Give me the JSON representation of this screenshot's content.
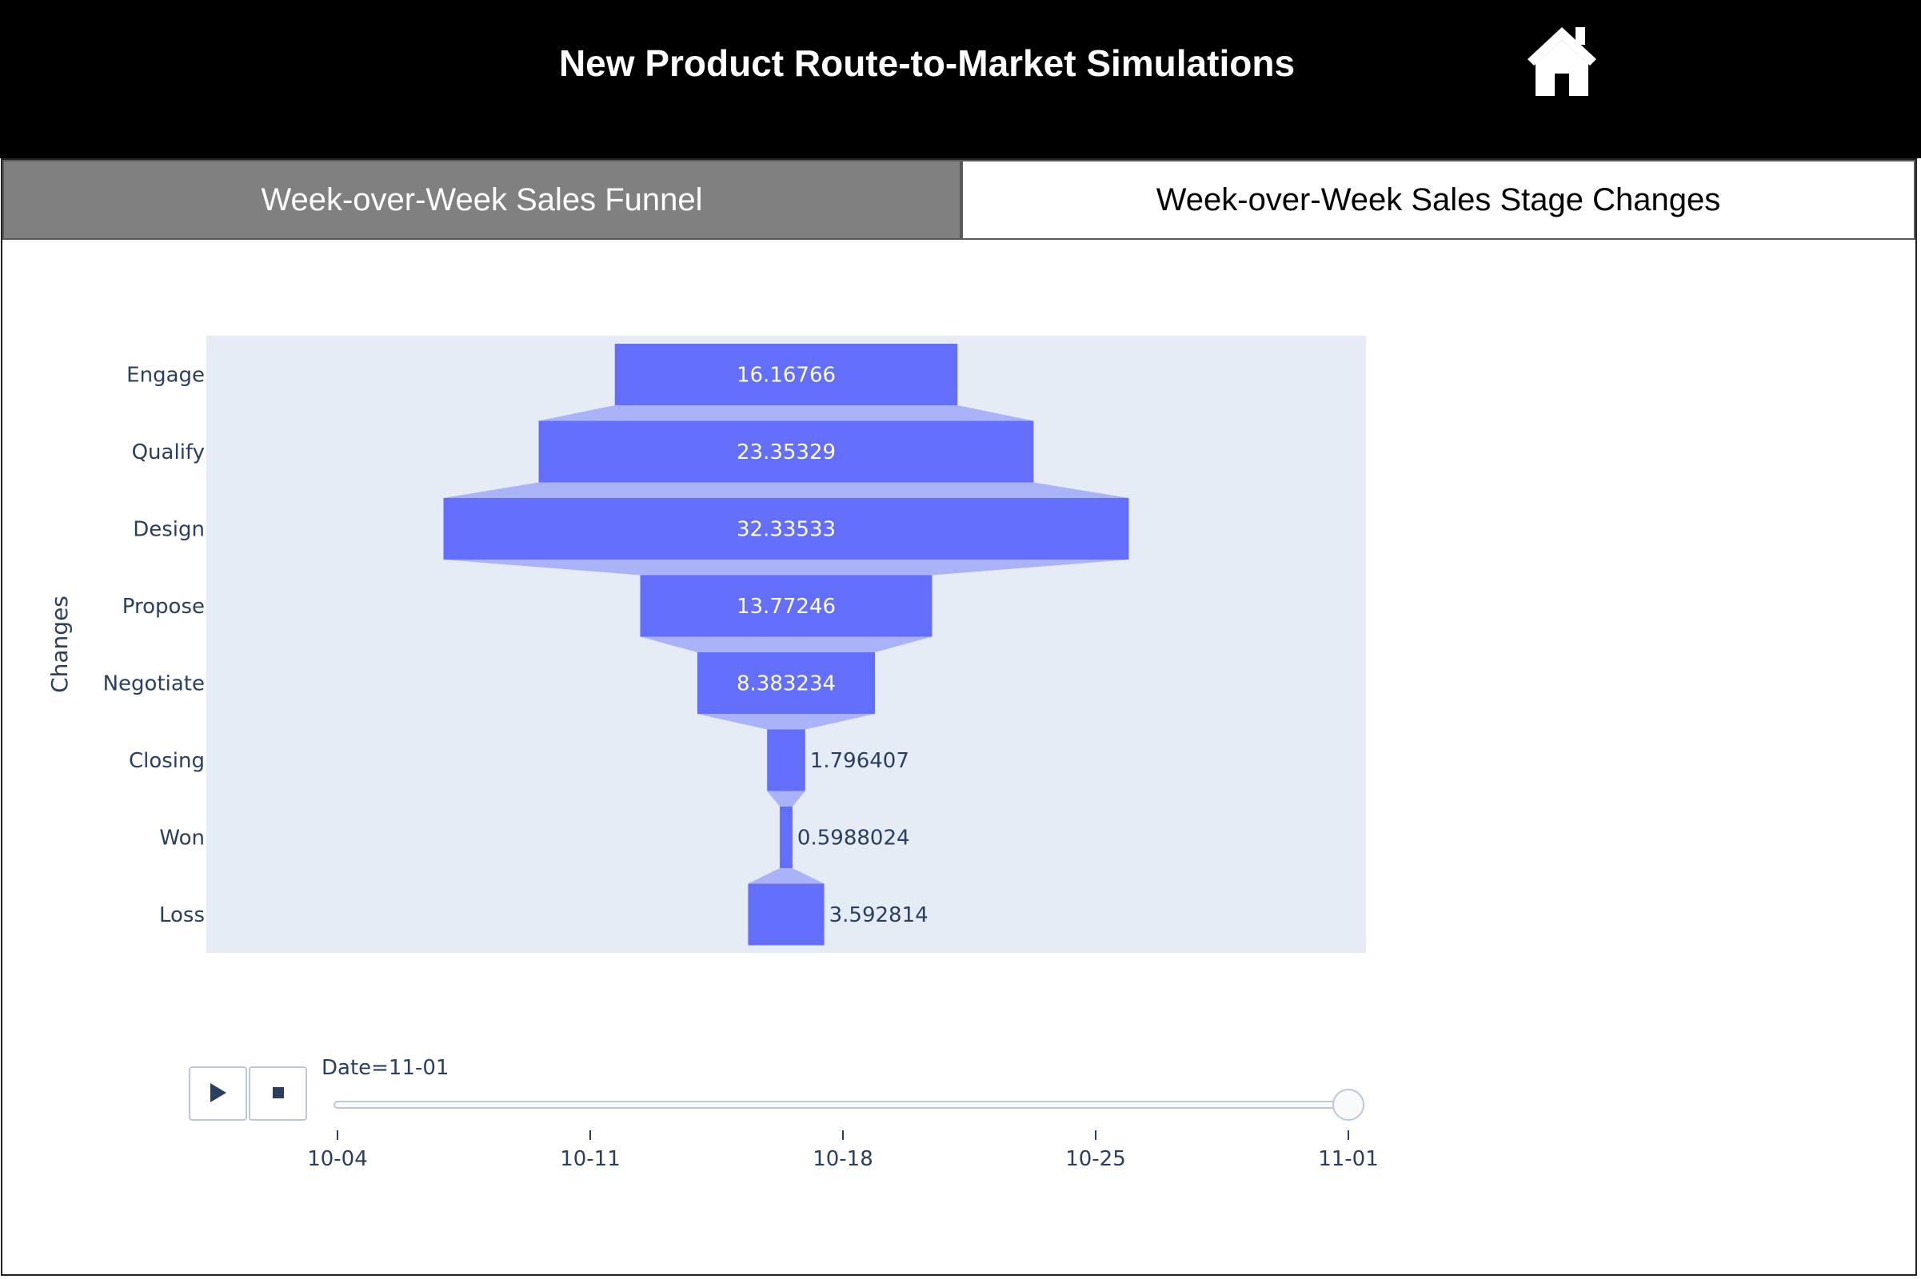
{
  "header": {
    "title": "New Product Route-to-Market Simulations",
    "home_icon": "home-icon"
  },
  "tabs": [
    {
      "label": "Week-over-Week Sales Funnel",
      "active": true
    },
    {
      "label": "Week-over-Week Sales Stage Changes",
      "active": false
    }
  ],
  "chart_data": {
    "type": "funnel",
    "ylabel": "Changes",
    "categories": [
      "Engage",
      "Qualify",
      "Design",
      "Propose",
      "Negotiate",
      "Closing",
      "Won",
      "Loss"
    ],
    "values": [
      16.16766,
      23.35329,
      32.33533,
      13.77246,
      8.383234,
      1.796407,
      0.5988024,
      3.592814
    ],
    "value_labels": [
      "16.16766",
      "23.35329",
      "32.33533",
      "13.77246",
      "8.383234",
      "1.796407",
      "0.5988024",
      "3.592814"
    ],
    "colors": {
      "bar": "#636efa",
      "plot_bg": "#e5ecf6",
      "text": "#2a3f5f"
    }
  },
  "animation": {
    "current_label": "Date=11-01",
    "ticks": [
      "10-04",
      "10-11",
      "10-18",
      "10-25",
      "11-01"
    ],
    "current_index": 4,
    "play_icon": "play-icon",
    "stop_icon": "stop-icon"
  }
}
